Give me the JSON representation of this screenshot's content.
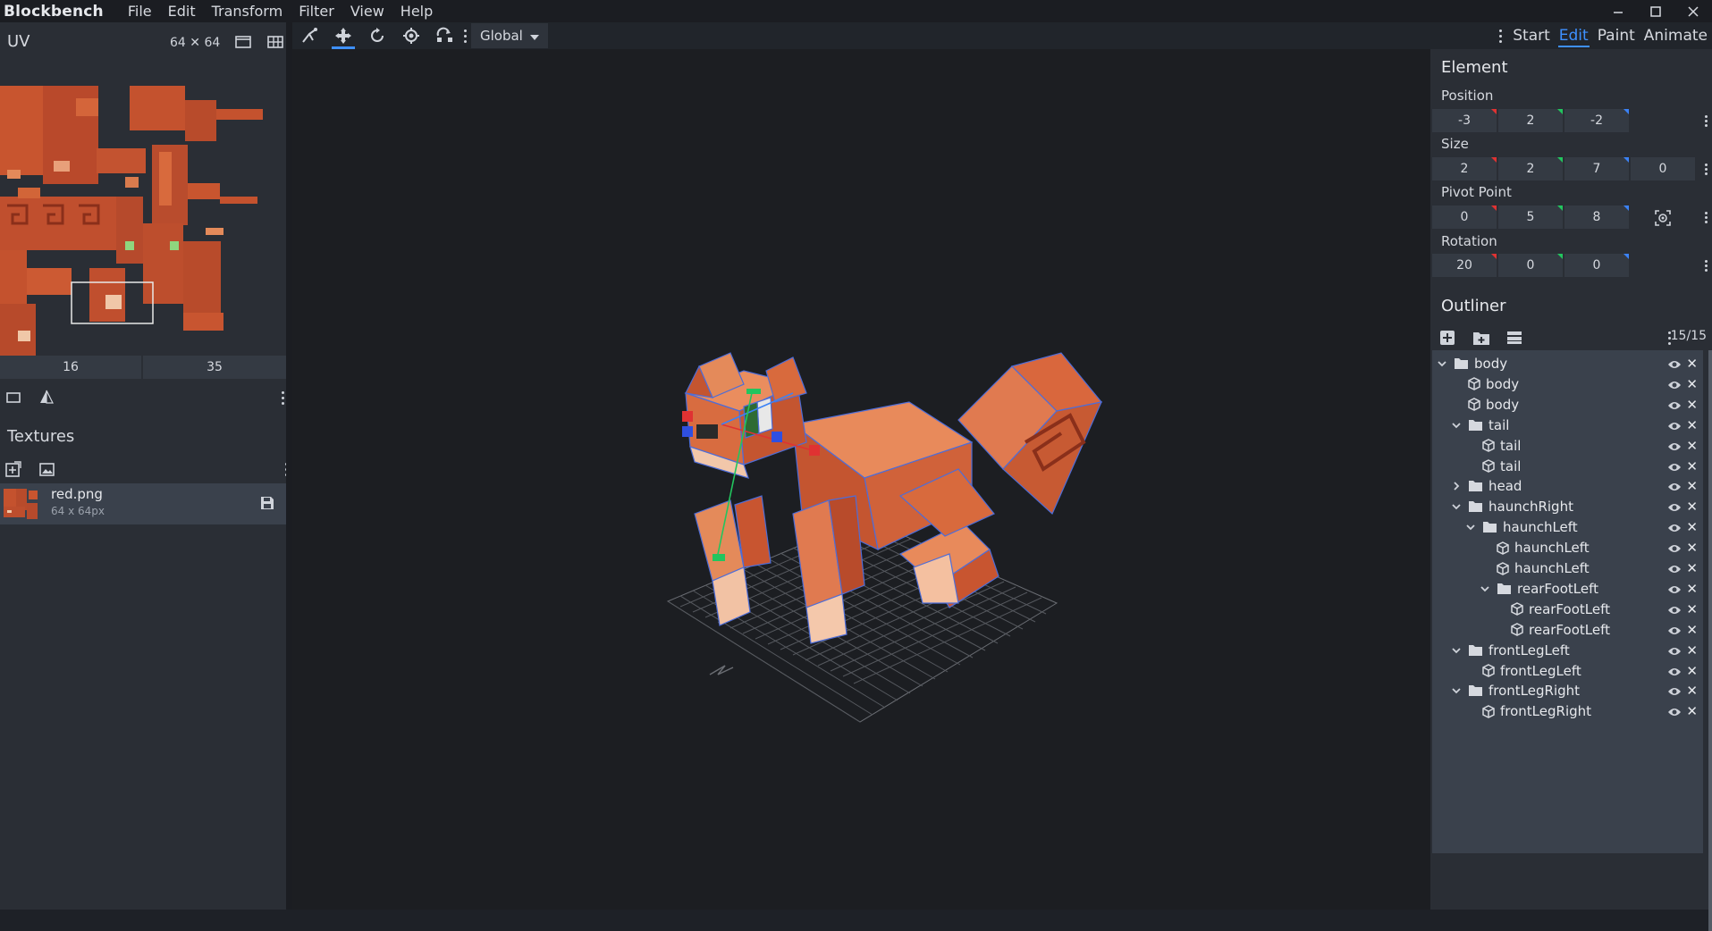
{
  "app": {
    "title": "Blockbench",
    "menu": [
      "File",
      "Edit",
      "Transform",
      "Filter",
      "View",
      "Help"
    ]
  },
  "toolbar": {
    "tools": [
      "vertex-snap-icon",
      "move-icon",
      "rotate-icon",
      "pivot-icon",
      "resize-icon"
    ],
    "space": "Global",
    "modes": [
      "Start",
      "Edit",
      "Paint",
      "Animate"
    ],
    "active_mode": "Edit"
  },
  "uv": {
    "title": "UV",
    "size_label": "64 ✕ 64",
    "inputs": [
      "16",
      "35"
    ]
  },
  "textures": {
    "title": "Textures",
    "items": [
      {
        "name": "red.png",
        "dims": "64 x 64px"
      }
    ]
  },
  "element": {
    "title": "Element",
    "position_label": "Position",
    "position": [
      "-3",
      "2",
      "-2"
    ],
    "size_label": "Size",
    "size": [
      "2",
      "2",
      "7",
      "0"
    ],
    "pivot_label": "Pivot Point",
    "pivot": [
      "0",
      "5",
      "8"
    ],
    "rotation_label": "Rotation",
    "rotation": [
      "20",
      "0",
      "0"
    ]
  },
  "outliner": {
    "title": "Outliner",
    "count": "15/15",
    "nodes": [
      {
        "label": "body",
        "type": "folder",
        "depth": 0,
        "expanded": true
      },
      {
        "label": "body",
        "type": "cube",
        "depth": 1
      },
      {
        "label": "body",
        "type": "cube",
        "depth": 1
      },
      {
        "label": "tail",
        "type": "folder",
        "depth": 1,
        "expanded": true
      },
      {
        "label": "tail",
        "type": "cube",
        "depth": 2
      },
      {
        "label": "tail",
        "type": "cube",
        "depth": 2
      },
      {
        "label": "head",
        "type": "folder",
        "depth": 1,
        "expanded": false
      },
      {
        "label": "haunchRight",
        "type": "folder",
        "depth": 1,
        "expanded": true
      },
      {
        "label": "haunchLeft",
        "type": "folder",
        "depth": 2,
        "expanded": true
      },
      {
        "label": "haunchLeft",
        "type": "cube",
        "depth": 3
      },
      {
        "label": "haunchLeft",
        "type": "cube",
        "depth": 3
      },
      {
        "label": "rearFootLeft",
        "type": "folder",
        "depth": 3,
        "expanded": true
      },
      {
        "label": "rearFootLeft",
        "type": "cube",
        "depth": 4
      },
      {
        "label": "rearFootLeft",
        "type": "cube",
        "depth": 4
      },
      {
        "label": "frontLegLeft",
        "type": "folder",
        "depth": 1,
        "expanded": true
      },
      {
        "label": "frontLegLeft",
        "type": "cube",
        "depth": 2
      },
      {
        "label": "frontLegRight",
        "type": "folder",
        "depth": 1,
        "expanded": true
      },
      {
        "label": "frontLegRight",
        "type": "cube",
        "depth": 2
      }
    ]
  },
  "colors": {
    "accent": "#3e90ff",
    "model_main": "#e0774e",
    "model_dark": "#a9442b",
    "model_light": "#f4b08e"
  }
}
